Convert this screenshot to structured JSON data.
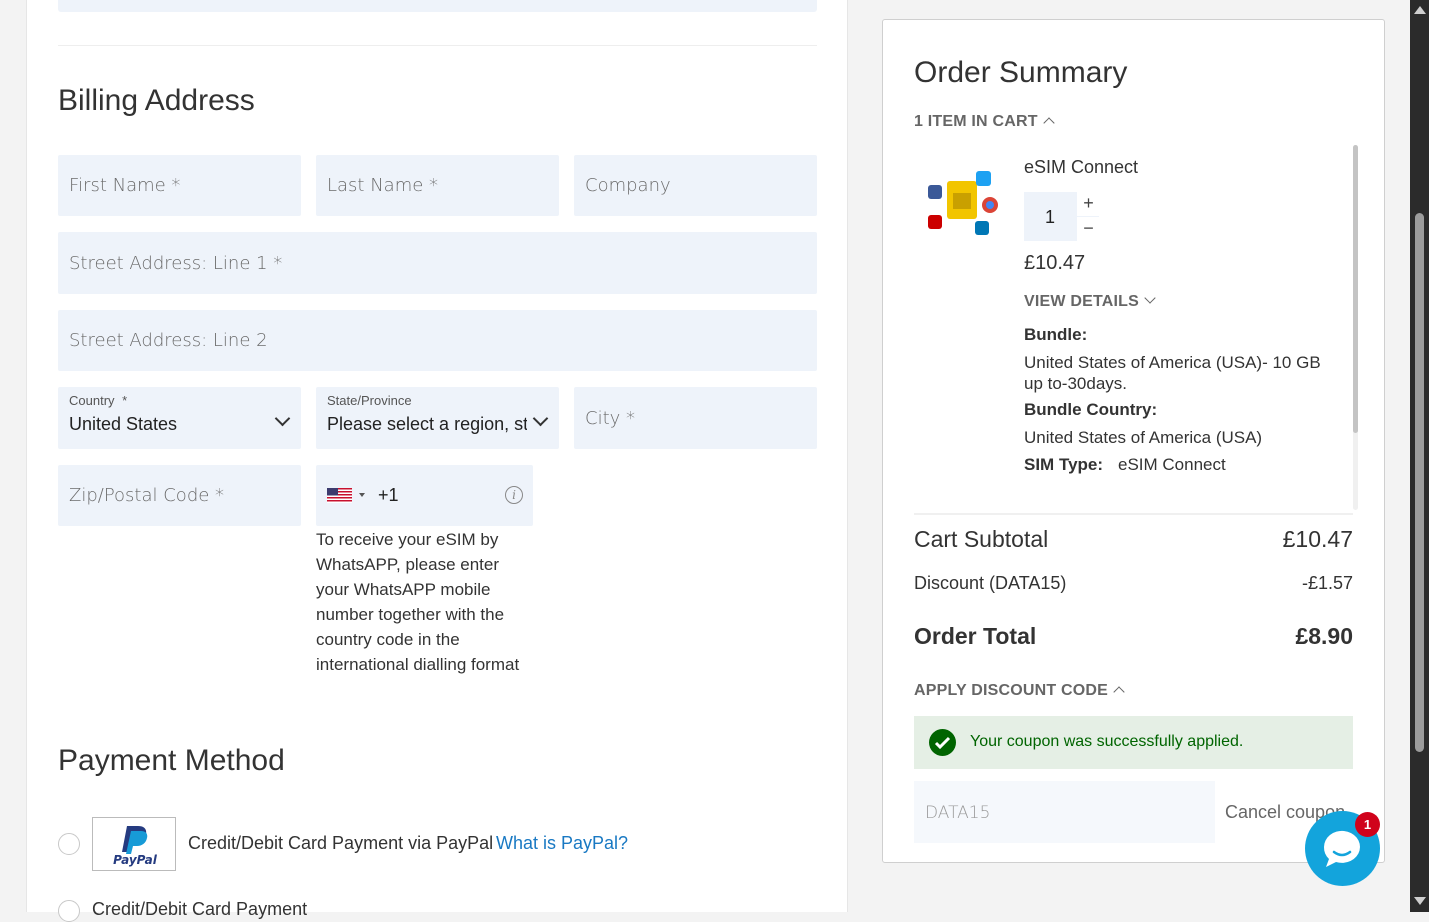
{
  "billing": {
    "title": "Billing Address",
    "first_name": "First Name *",
    "last_name": "Last Name *",
    "company": "Company",
    "street1": "Street Address: Line 1 *",
    "street2": "Street Address: Line 2",
    "country_label": "Country",
    "country_required": "*",
    "country_value": "United States",
    "state_label": "State/Province",
    "state_value": "Please select a region, st",
    "city": "City *",
    "zip": "Zip/Postal Code *",
    "phone_code": "+1",
    "phone_info_icon": "i",
    "whatsapp_note": "To receive your eSIM by WhatsAPP, please enter your WhatsAPP mobile number together with the country code in the international dialling format"
  },
  "payment": {
    "title": "Payment Method",
    "paypal_logo_text": "PayPal",
    "option1_label": "Credit/Debit Card Payment via PayPal",
    "option1_link": "What is PayPal?",
    "option2_label": "Credit/Debit Card Payment"
  },
  "summary": {
    "title": "Order Summary",
    "items_in_cart": "1 ITEM IN CART",
    "product_name": "eSIM Connect",
    "qty": "1",
    "qty_plus": "+",
    "qty_minus": "−",
    "price": "£10.47",
    "view_details": "VIEW DETAILS",
    "bundle_label": "Bundle:",
    "bundle_value": "United States of America (USA)- 10 GB up to-30days.",
    "bundle_country_label": "Bundle Country:",
    "bundle_country_value": "United States of America (USA)",
    "sim_type_label": "SIM Type:",
    "sim_type_value": "eSIM Connect",
    "subtotal_label": "Cart Subtotal",
    "subtotal_value": "£10.47",
    "discount_label": "Discount (DATA15)",
    "discount_value": "-£1.57",
    "total_label": "Order Total",
    "total_value": "£8.90",
    "apply_discount": "APPLY DISCOUNT CODE",
    "coupon_success": "Your coupon was successfully applied.",
    "coupon_code": "DATA15",
    "cancel_coupon": "Cancel coupon"
  },
  "chat": {
    "badge_count": "1"
  },
  "colors": {
    "accent_link": "#1979c3",
    "success_bg": "#e5efe5",
    "success_text": "#006400",
    "chat": "#13a4dc",
    "field_bg": "#eef3fa"
  }
}
